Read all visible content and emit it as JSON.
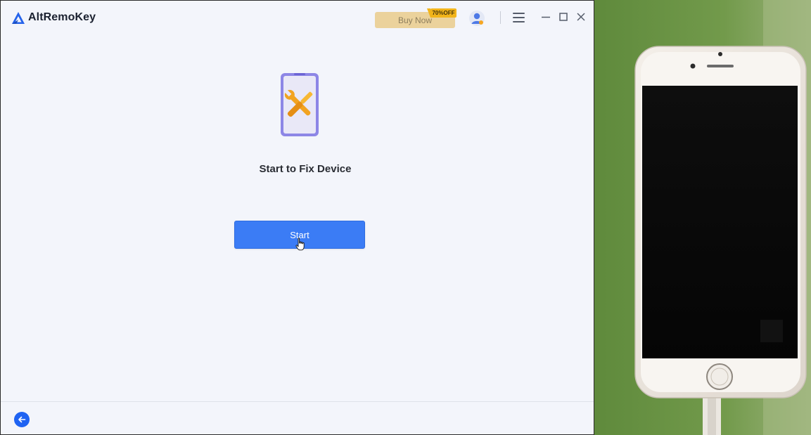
{
  "app": {
    "title": "AltRemoKey",
    "brand_color": "#2563eb"
  },
  "header": {
    "buy_label": "Buy Now",
    "discount_badge": "70%OFF"
  },
  "main": {
    "heading": "Start to Fix Device",
    "start_label": "Start",
    "accent_color": "#3b7cf5"
  },
  "icons": {
    "logo": "altremokey-logo-icon",
    "user": "user-avatar-icon",
    "menu": "hamburger-menu-icon",
    "minimize": "minimize-icon",
    "maximize": "maximize-icon",
    "close": "close-icon",
    "repair": "phone-repair-tools-icon",
    "back": "arrow-left-icon"
  }
}
